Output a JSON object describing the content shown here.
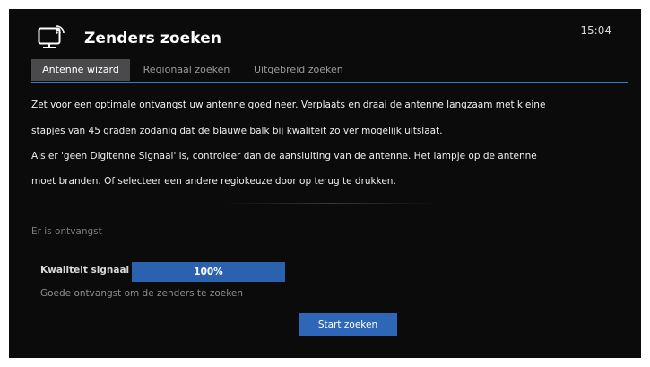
{
  "header": {
    "icon": "tv-signal-icon",
    "title": "Zenders zoeken",
    "clock": "15:04"
  },
  "tabs": [
    {
      "label": "Antenne wizard",
      "active": true
    },
    {
      "label": "Regionaal zoeken",
      "active": false
    },
    {
      "label": "Uitgebreid zoeken",
      "active": false
    }
  ],
  "instructions": [
    "Zet voor een optimale ontvangst uw antenne goed neer. Verplaats en draai de antenne langzaam met kleine",
    "stapjes van 45 graden zodanig dat de blauwe balk bij kwaliteit zo ver mogelijk uitslaat.",
    "Als er 'geen Digitenne Signaal' is, controleer dan de aansluiting van de antenne. Het lampje op de antenne",
    "moet branden. Of selecteer een andere regiokeuze door op terug te drukken."
  ],
  "reception_status": "Er is ontvangst",
  "signal": {
    "label": "Kwaliteit signaal",
    "value_text": "100%",
    "level": 1.0,
    "message": "Goede ontvangst om de zenders te zoeken"
  },
  "actions": {
    "start_label": "Start zoeken"
  },
  "colors": {
    "background": "#0b0b0c",
    "accent": "#2e66b8",
    "tab_active": "#4a4a4c",
    "tab_underline": "#3a78d6"
  }
}
